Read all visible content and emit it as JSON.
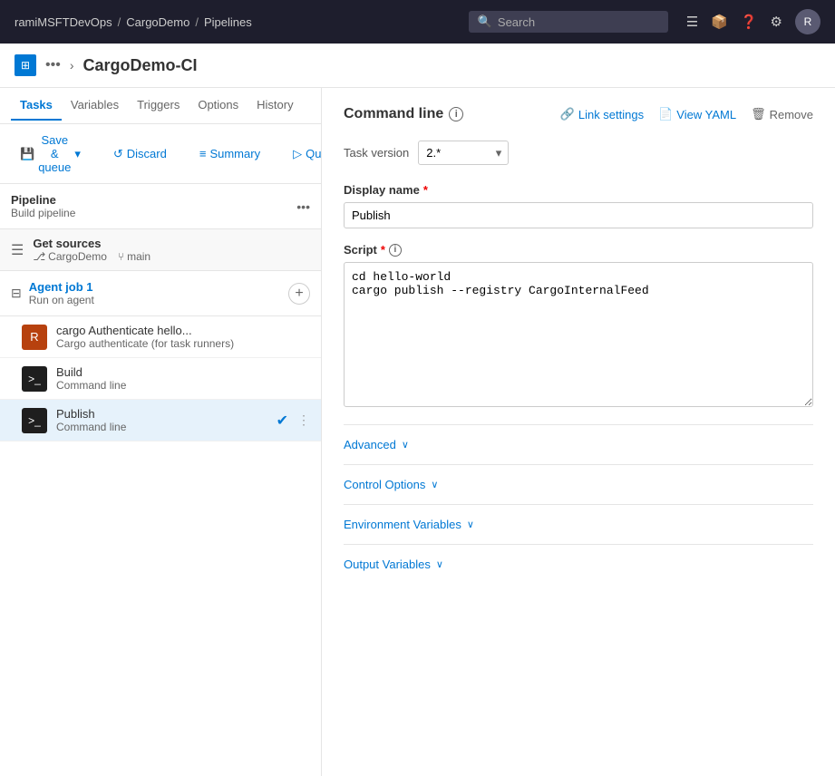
{
  "topnav": {
    "breadcrumbs": [
      {
        "label": "ramiMSFTDevOps",
        "href": "#"
      },
      {
        "label": "CargoDemo",
        "href": "#"
      },
      {
        "label": "Pipelines",
        "href": "#"
      }
    ],
    "search_placeholder": "Search",
    "icons": [
      "list-icon",
      "package-icon",
      "help-icon",
      "settings-icon"
    ],
    "avatar_initials": "R"
  },
  "page_header": {
    "icon_symbol": "⚙",
    "more_label": "•••",
    "title": "CargoDemo-CI"
  },
  "tabs": [
    {
      "label": "Tasks",
      "active": true
    },
    {
      "label": "Variables",
      "active": false
    },
    {
      "label": "Triggers",
      "active": false
    },
    {
      "label": "Options",
      "active": false
    },
    {
      "label": "History",
      "active": false
    }
  ],
  "toolbar": {
    "save_queue_label": "Save & queue",
    "discard_label": "Discard",
    "summary_label": "Summary",
    "queue_label": "Queue",
    "more_dots": "•••"
  },
  "pipeline": {
    "title": "Pipeline",
    "subtitle": "Build pipeline",
    "more_dots": "•••"
  },
  "get_sources": {
    "title": "Get sources",
    "repo": "CargoDemo",
    "branch": "main"
  },
  "agent_job": {
    "title": "Agent job 1",
    "subtitle": "Run on agent"
  },
  "tasks": [
    {
      "id": "cargo-auth",
      "icon_type": "rust",
      "icon_text": "R",
      "title": "cargo Authenticate hello...",
      "subtitle": "Cargo authenticate (for task runners)",
      "selected": false,
      "checked": false
    },
    {
      "id": "build",
      "icon_type": "cmd",
      "icon_text": ">_",
      "title": "Build",
      "subtitle": "Command line",
      "selected": false,
      "checked": false
    },
    {
      "id": "publish",
      "icon_type": "cmd",
      "icon_text": ">_",
      "title": "Publish",
      "subtitle": "Command line",
      "selected": true,
      "checked": true
    }
  ],
  "right_panel": {
    "section_title": "Command line",
    "link_settings_label": "Link settings",
    "view_yaml_label": "View YAML",
    "remove_label": "Remove",
    "task_version_label": "Task version",
    "task_version_value": "2.*",
    "display_name_label": "Display name",
    "display_name_required": "*",
    "display_name_value": "Publish",
    "script_label": "Script",
    "script_required": "*",
    "script_line1": "cd hello-world",
    "script_line2": "cargo publish --registry CargoInternalFeed",
    "advanced_label": "Advanced",
    "control_options_label": "Control Options",
    "environment_variables_label": "Environment Variables",
    "output_variables_label": "Output Variables"
  }
}
